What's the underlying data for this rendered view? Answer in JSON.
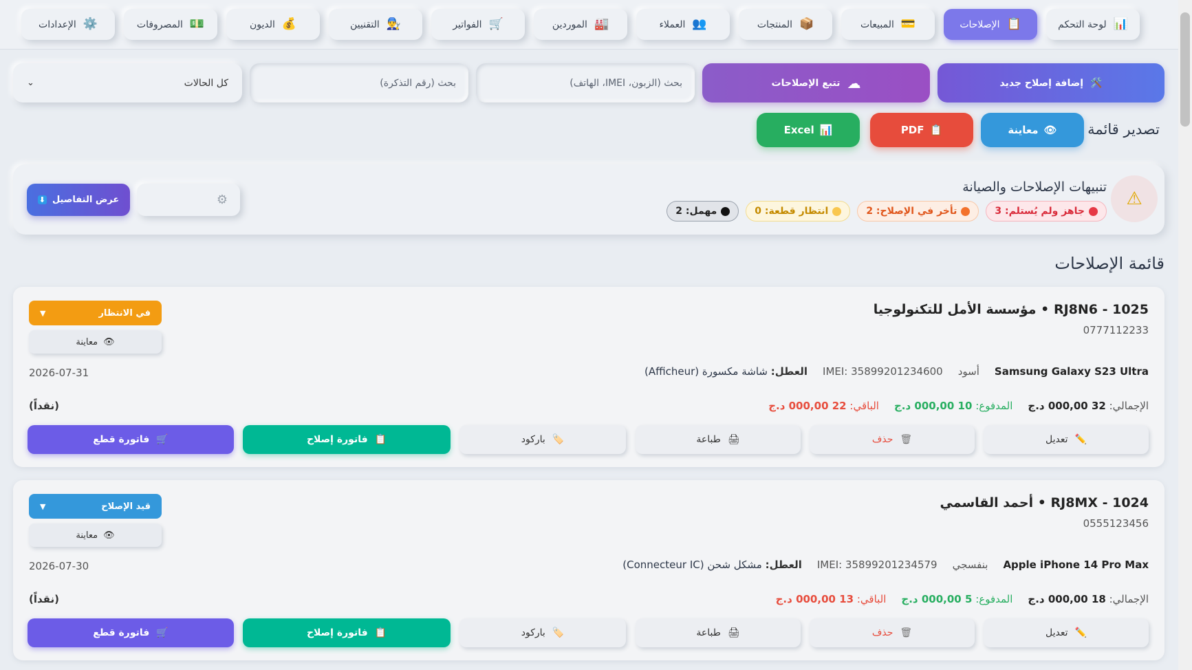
{
  "nav": [
    {
      "label": "لوحة التحكم",
      "icon": "📊",
      "name": "nav-dashboard"
    },
    {
      "label": "الإصلاحات",
      "icon": "📋",
      "name": "nav-repairs",
      "active": true
    },
    {
      "label": "المبيعات",
      "icon": "💳",
      "name": "nav-sales"
    },
    {
      "label": "المنتجات",
      "icon": "📦",
      "name": "nav-products"
    },
    {
      "label": "العملاء",
      "icon": "👥",
      "name": "nav-clients"
    },
    {
      "label": "الموردين",
      "icon": "🏭",
      "name": "nav-suppliers"
    },
    {
      "label": "الفواتير",
      "icon": "🛒",
      "name": "nav-invoices"
    },
    {
      "label": "التقنيين",
      "icon": "👨‍🔧",
      "name": "nav-technicians"
    },
    {
      "label": "الديون",
      "icon": "💰",
      "name": "nav-debts"
    },
    {
      "label": "المصروفات",
      "icon": "💵",
      "name": "nav-expenses"
    },
    {
      "label": "الإعدادات",
      "icon": "⚙️",
      "name": "nav-settings"
    }
  ],
  "toolbar": {
    "add_label": "إضافة إصلاح جديد",
    "add_icon": "🛠️",
    "track_label": "تتبع الإصلاحات",
    "track_icon": "☁",
    "search_client_placeholder": "بحث (الزبون، IMEI، الهاتف)",
    "search_ticket_placeholder": "بحث (رقم التذكرة)",
    "status_filter": "كل الحالات"
  },
  "export": {
    "label": "تصدير قائمة",
    "preview": "معاينة",
    "preview_icon": "👁",
    "pdf": "PDF",
    "pdf_icon": "📋",
    "excel": "Excel",
    "excel_icon": "📊"
  },
  "alerts": {
    "title": "تنبيهات الإصلاحات والصيانة",
    "icon": "⚠",
    "chips": [
      {
        "label": "جاهز ولم يُستلم: 3",
        "color": "#e63946",
        "cls": "chip-red"
      },
      {
        "label": "تأخر في الإصلاح: 2",
        "color": "#f3722c",
        "cls": "chip-orange"
      },
      {
        "label": "انتظار قطعة: 0",
        "color": "#f9c74f",
        "cls": "chip-yellow"
      },
      {
        "label": "مهمل: 2",
        "color": "#111111",
        "cls": "chip-black"
      }
    ],
    "settings_icon": "⚙",
    "details_label": "عرض التفاصيل",
    "details_icon": "⬇"
  },
  "list_title": "قائمة الإصلاحات",
  "repairs": [
    {
      "title": "1025 - RJ8N6  •  مؤسسة الأمل للتكنولوجيا",
      "phone": "0777112233",
      "status": "في الانتظار",
      "status_cls": "st-wait",
      "preview": "معاينة",
      "device": "Samsung Galaxy S23 Ultra",
      "color": "أسود",
      "imei": "IMEI: 35899201234600",
      "fault_label": "العطل:",
      "fault": "شاشة مكسورة (Afficheur)",
      "date": "2026-07-31",
      "total_label": "الإجمالي:",
      "total": "32 000,00 د.ج",
      "paid_label": "المدفوع:",
      "paid": "10 000,00 د.ج",
      "rest_label": "الباقي:",
      "rest": "22 000,00 د.ج",
      "pay_method": "(نقداً)"
    },
    {
      "title": "1024 - RJ8MX  •  أحمد القاسمي",
      "phone": "0555123456",
      "status": "قيد الإصلاح",
      "status_cls": "st-repair",
      "preview": "معاينة",
      "device": "Apple iPhone 14 Pro Max",
      "color": "بنفسجي",
      "imei": "IMEI: 35899201234579",
      "fault_label": "العطل:",
      "fault": "مشكل شحن (Connecteur IC)",
      "date": "2026-07-30",
      "total_label": "الإجمالي:",
      "total": "18 000,00 د.ج",
      "paid_label": "المدفوع:",
      "paid": "5 000,00 د.ج",
      "rest_label": "الباقي:",
      "rest": "13 000,00 د.ج",
      "pay_method": "(نقداً)"
    }
  ],
  "actions": {
    "edit": "تعديل",
    "edit_icon": "✏️",
    "delete": "حذف",
    "delete_icon": "🗑",
    "print": "طباعة",
    "print_icon": "🖨",
    "barcode": "باركود",
    "barcode_icon": "🏷️",
    "repair_invoice": "فاتورة إصلاح",
    "repair_invoice_icon": "📋",
    "parts_invoice": "فاتورة قطع",
    "parts_invoice_icon": "🛒"
  },
  "status_arrow": "▼"
}
